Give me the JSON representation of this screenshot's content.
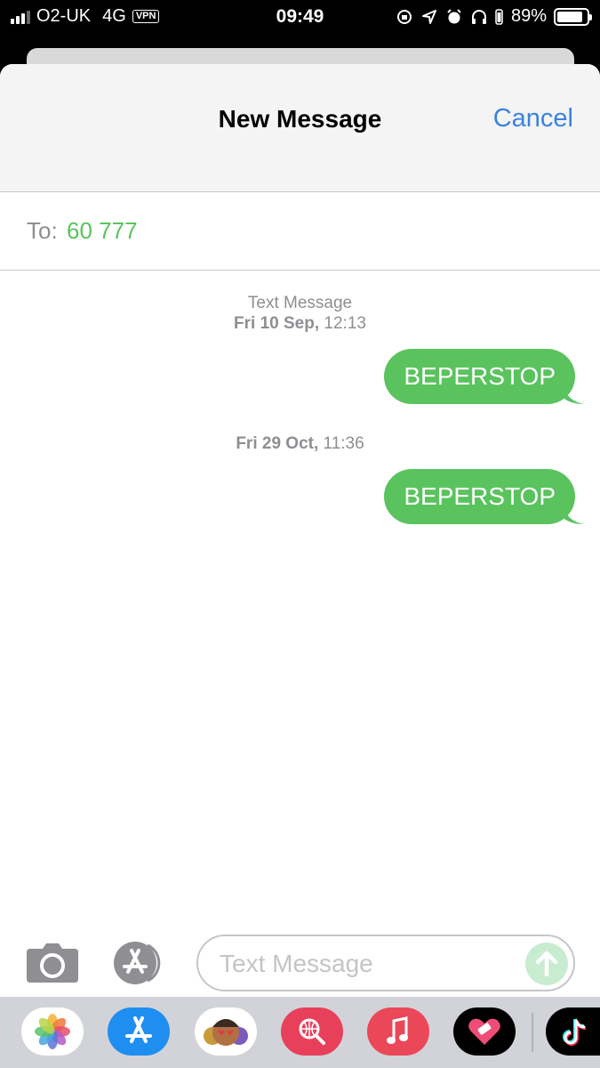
{
  "status_bar": {
    "carrier": "O2-UK",
    "network": "4G",
    "vpn": "VPN",
    "time": "09:49",
    "battery": "89%",
    "battery_level": 0.89
  },
  "header": {
    "title": "New Message",
    "cancel_label": "Cancel"
  },
  "to_field": {
    "label": "To:",
    "recipient": "60 777"
  },
  "conversation": [
    {
      "meta_title": "Text Message",
      "meta_time_day": "Fri 10 Sep,",
      "meta_time_clock": "12:13",
      "message": "BEPERSTOP"
    },
    {
      "meta_title": "",
      "meta_time_day": "Fri 29 Oct,",
      "meta_time_clock": "11:36",
      "message": "BEPERSTOP"
    }
  ],
  "composer": {
    "placeholder": "Text Message",
    "camera_icon": "camera-icon",
    "apps_icon": "app-store-icon",
    "send_icon": "send-arrow-icon"
  },
  "app_drawer": {
    "items": [
      "photos-icon",
      "app-store-icon",
      "memoji-icon",
      "search-images-icon",
      "music-icon",
      "heart-sticker-icon",
      "tiktok-icon"
    ]
  },
  "colors": {
    "bubble": "#5ac35e",
    "link": "#3a82e0",
    "meta": "#8e8e93"
  }
}
